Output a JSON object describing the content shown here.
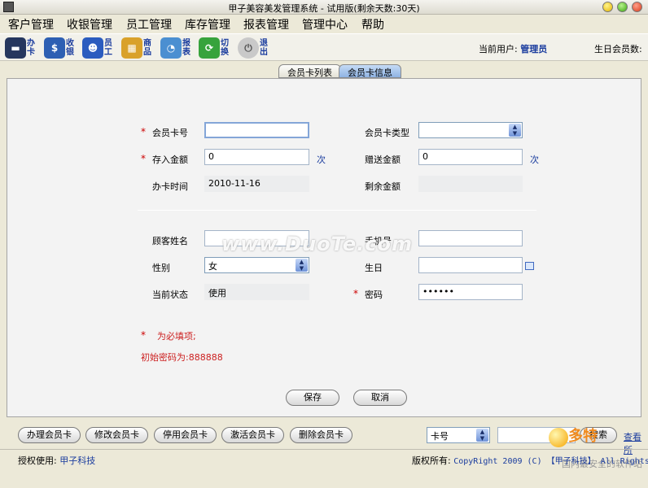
{
  "window": {
    "title": "甲子美容美发管理系统 - 试用版(剩余天数:30天)"
  },
  "menu": [
    "客户管理",
    "收银管理",
    "员工管理",
    "库存管理",
    "报表管理",
    "管理中心",
    "帮助"
  ],
  "toolbar": [
    {
      "label": "办卡",
      "icon": "card-icon",
      "color": "#26375e",
      "glyph": "▬"
    },
    {
      "label": "收银",
      "icon": "cashier-icon",
      "color": "#2d5fb3",
      "glyph": "$"
    },
    {
      "label": "员工",
      "icon": "staff-icon",
      "color": "#2b5cbf",
      "glyph": "☻"
    },
    {
      "label": "商品",
      "icon": "goods-icon",
      "color": "#d9a12a",
      "glyph": "▦"
    },
    {
      "label": "报表",
      "icon": "report-icon",
      "color": "#4b8fd1",
      "glyph": "◔"
    },
    {
      "label": "切换",
      "icon": "switch-icon",
      "color": "#37a33c",
      "glyph": "⟳"
    },
    {
      "label": "退出",
      "icon": "power-icon",
      "color": "#c9c9c9",
      "glyph": "⏻"
    }
  ],
  "user": {
    "current_label": "当前用户:",
    "current_value": "管理员",
    "birthday_label": "生日会员数:"
  },
  "tabs": {
    "list": "会员卡列表",
    "info": "会员卡信息"
  },
  "form": {
    "card_no_label": "会员卡号",
    "card_no_value": "",
    "card_type_label": "会员卡类型",
    "card_type_value": "",
    "deposit_label": "存入金额",
    "deposit_value": "0",
    "deposit_unit": "次",
    "bonus_label": "赠送金额",
    "bonus_value": "0",
    "bonus_unit": "次",
    "issue_time_label": "办卡时间",
    "issue_time_value": "2010-11-16",
    "balance_label": "剩余金额",
    "balance_value": "",
    "customer_name_label": "顾客姓名",
    "customer_name_value": "",
    "phone_label": "手机号",
    "phone_value": "",
    "gender_label": "性别",
    "gender_value": "女",
    "birthday_label": "生日",
    "birthday_value": "",
    "status_label": "当前状态",
    "status_value": "使用",
    "password_label": "密码",
    "password_value": "••••••",
    "required_mark": "*",
    "required_note": "为必填项;",
    "initial_password_note": "初始密码为:888888",
    "save_label": "保存",
    "cancel_label": "取消"
  },
  "actions": [
    "办理会员卡",
    "修改会员卡",
    "停用会员卡",
    "激活会员卡",
    "删除会员卡"
  ],
  "search": {
    "field_value": "卡号",
    "query_value": "",
    "button_label": "搜索",
    "view_label": "查看所"
  },
  "watermark": "www.DuoTe.com",
  "statusbar": {
    "licensed_label": "授权使用:",
    "licensed_value": "甲子科技",
    "copyright_label": "版权所有:",
    "copyright_value": "CopyRight 2009 (C) 【甲子科技】 All Rights Reser"
  },
  "corner_logo": {
    "big": "多特",
    "small": "国内最安全的软件站"
  }
}
